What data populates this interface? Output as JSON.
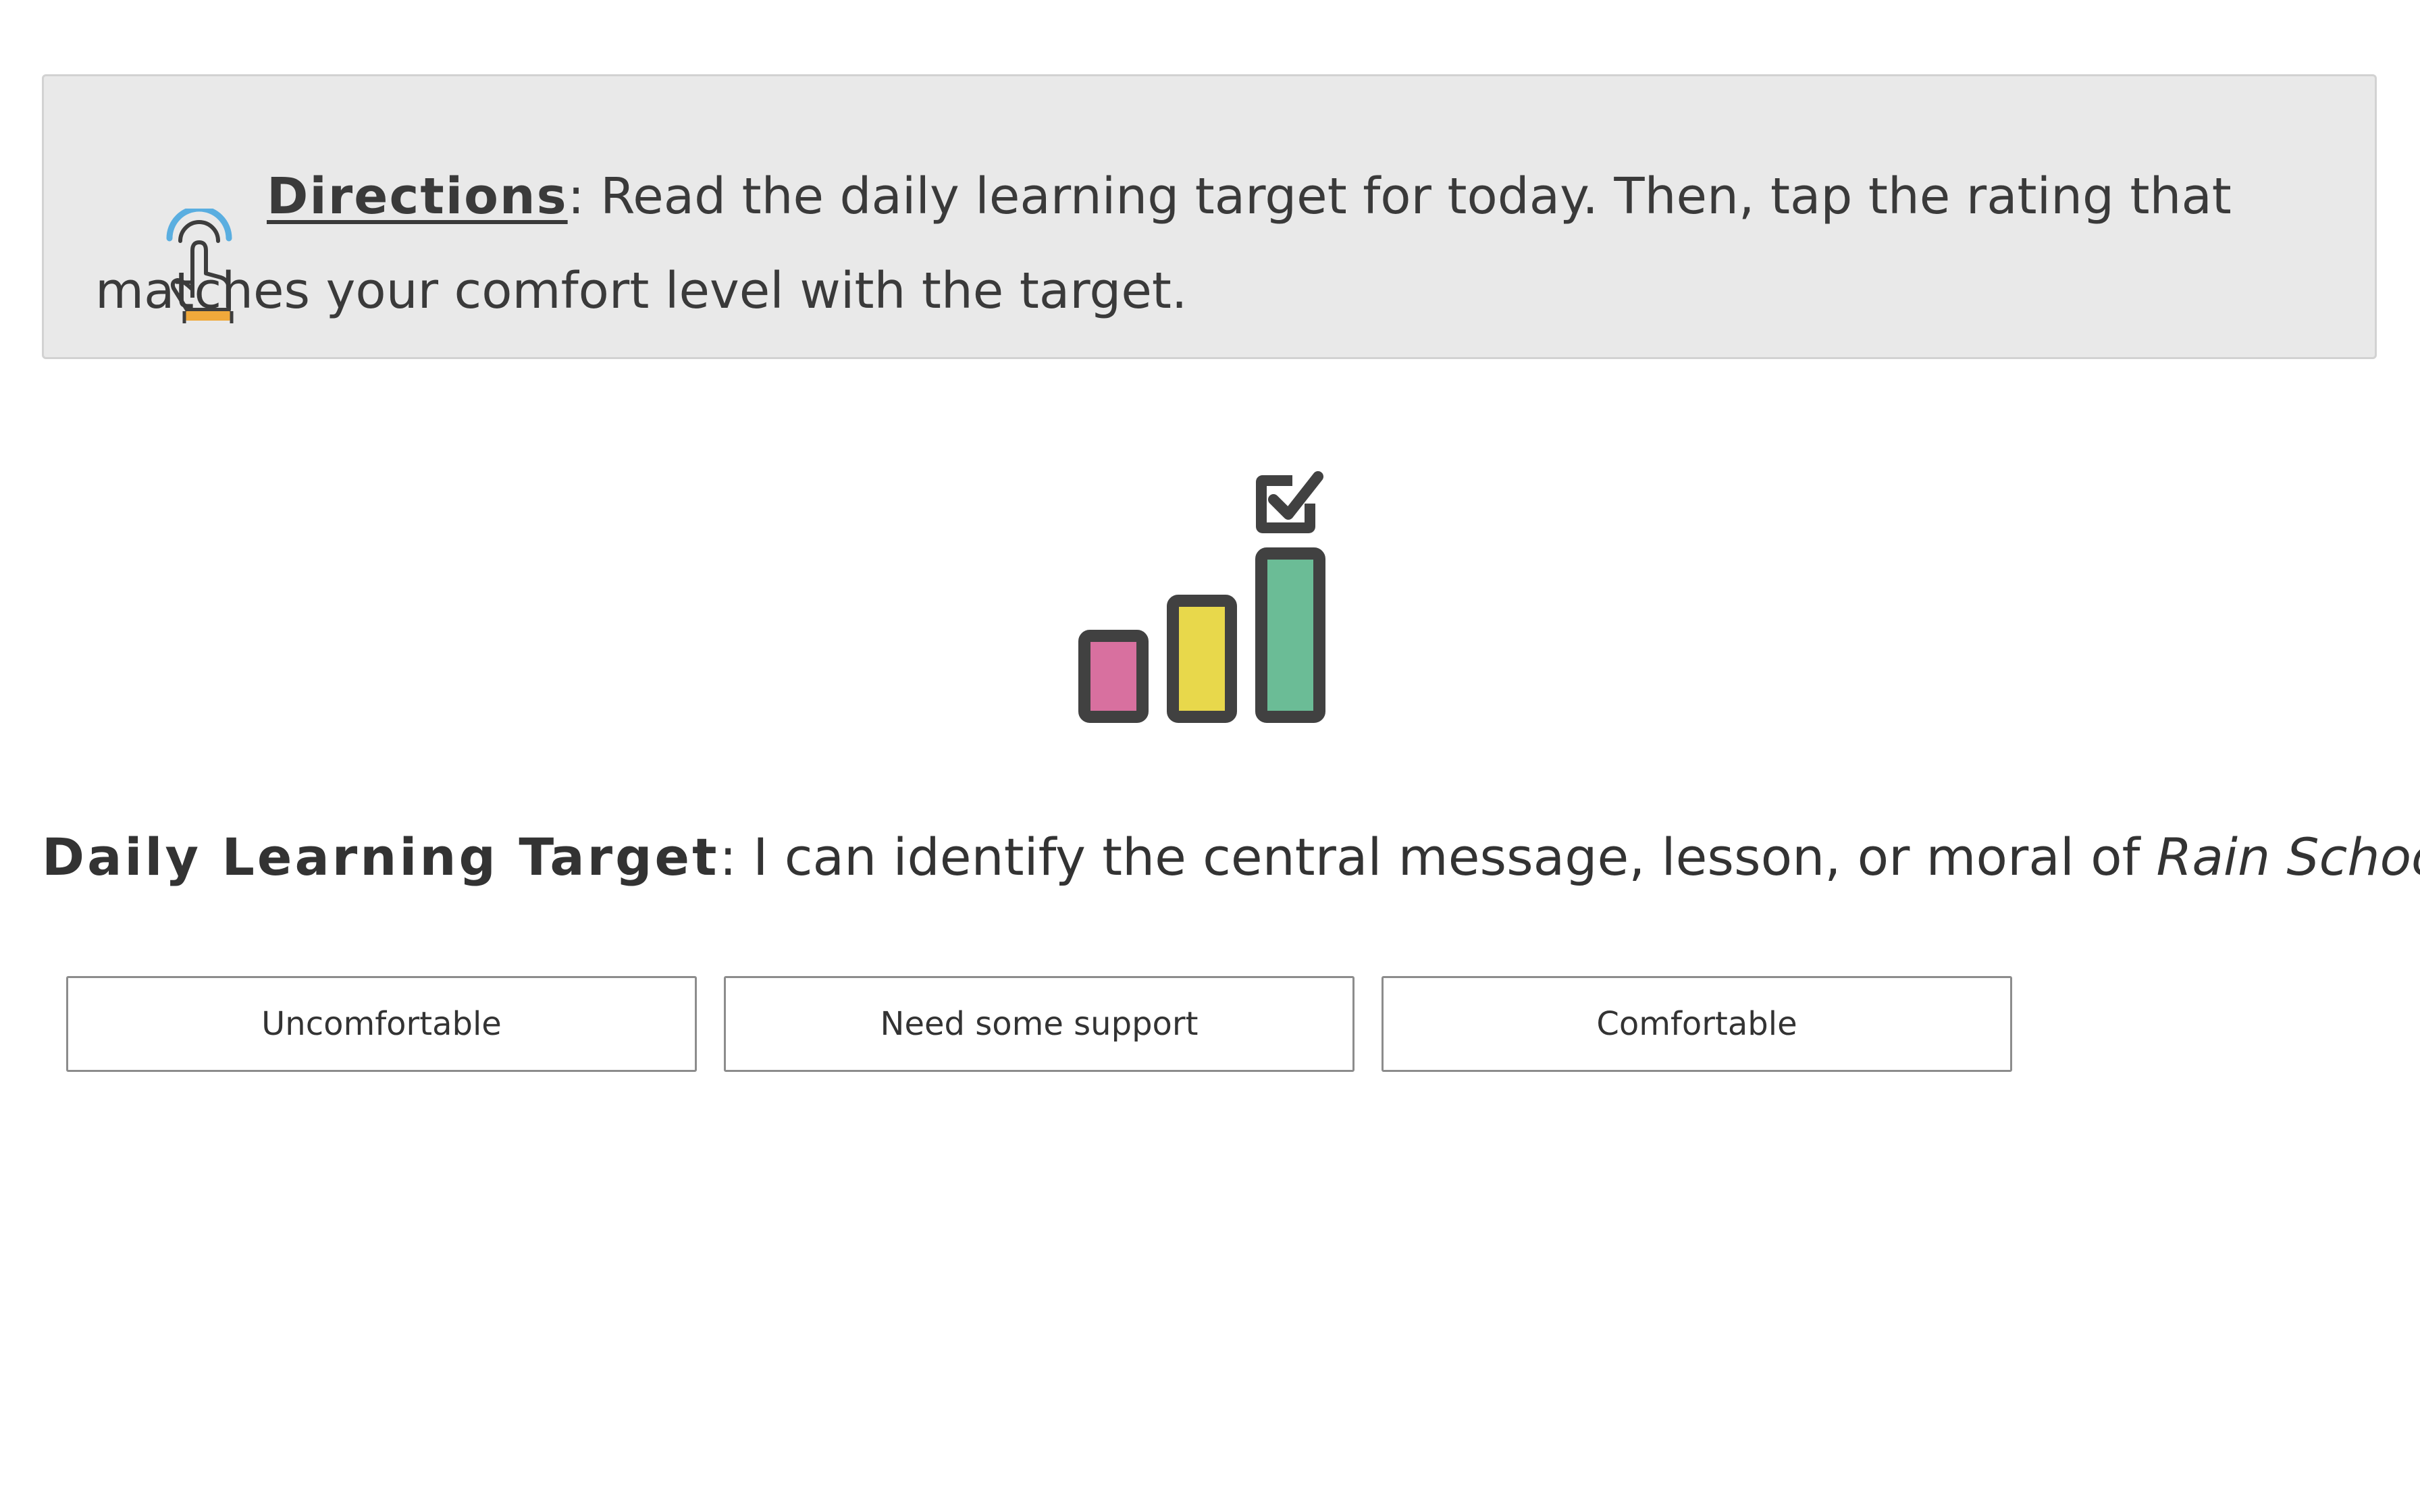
{
  "directions": {
    "label": "Directions",
    "text": ": Read the daily learning target for today. Then, tap the rating that matches your comfort level with the target."
  },
  "target": {
    "label": "Daily Learning Target",
    "text": ": I can identify the central message, lesson, or moral of ",
    "title": "Rain School",
    "end": "."
  },
  "ratings": [
    {
      "label": "Uncomfortable"
    },
    {
      "label": "Need some support"
    },
    {
      "label": "Comfortable"
    }
  ],
  "icons": {
    "directions_icon": "tap-finger-icon",
    "rating_icon": "rating-bars-checkbox-icon"
  },
  "colors": {
    "panel_bg": "#e9e9e9",
    "bar_low": "#d8709f",
    "bar_mid": "#e8d84b",
    "bar_high": "#6bbc96",
    "icon_outline": "#414141",
    "tap_signal": "#5aaee0",
    "tap_cuff": "#f0a93b"
  }
}
